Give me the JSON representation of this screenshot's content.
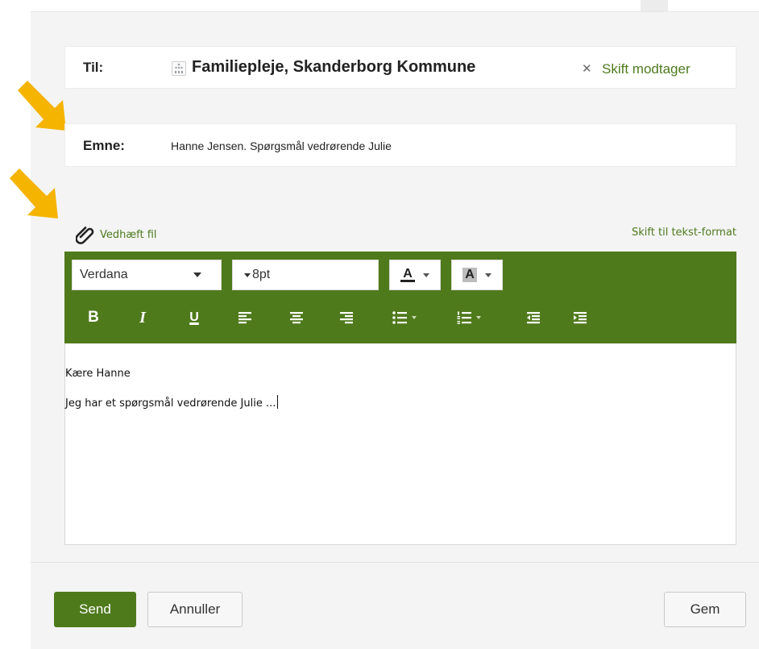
{
  "recipient": {
    "label": "Til:",
    "name": "Familiepleje, Skanderborg Kommune",
    "icon": "organization-icon",
    "remove_icon": "close-icon",
    "change_label": "Skift modtager"
  },
  "subject": {
    "label": "Emne:",
    "value": "Hanne Jensen. Spørgsmål vedrørende Julie"
  },
  "attachments": {
    "icon": "paperclip-icon",
    "label": "Vedhæft fil"
  },
  "editor_mode": {
    "switch_label": "Skift til tekst-format"
  },
  "toolbar": {
    "font": "Verdana",
    "size": "8pt",
    "text_color_label": "A",
    "highlight_label": "A",
    "bold_label": "B",
    "italic_label": "I",
    "underline_label": "U",
    "background": "#4f7a1c"
  },
  "editor": {
    "lines": [
      "Kære Hanne",
      "Jeg har et spørgsmål vedrørende Julie ..."
    ]
  },
  "actions": {
    "send": "Send",
    "cancel": "Annuller",
    "save": "Gem"
  },
  "annotations": {
    "arrow_color": "#f5b400"
  }
}
